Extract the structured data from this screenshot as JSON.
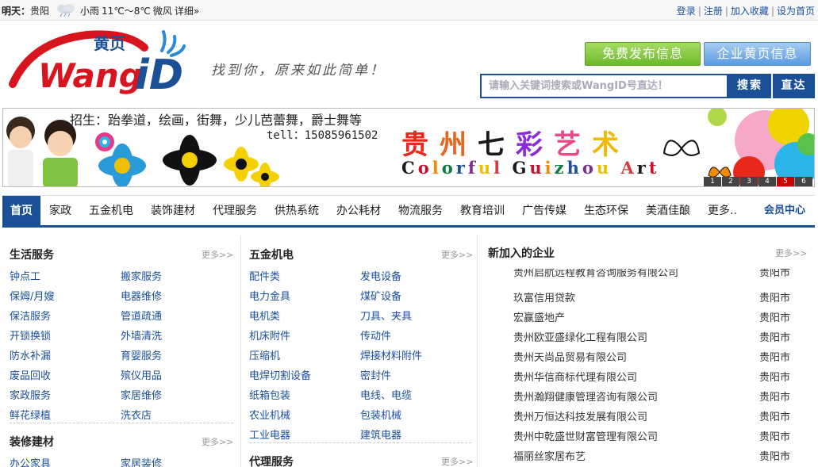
{
  "weather": {
    "label": "明天：",
    "city": "贵阳",
    "icon": "light-rain-icon",
    "condition": "小雨",
    "temp": "11℃～8℃",
    "wind": "微风",
    "detail": "详细»"
  },
  "toplinks": {
    "login": "登录",
    "register": "注册",
    "favorite": "加入收藏",
    "homepage": "设为首页",
    "sep": "|"
  },
  "logo": {
    "cn": "黄页",
    "en": "WangID"
  },
  "slogan": "找到你，原来如此简单！",
  "header": {
    "free_post": "免费发布信息",
    "yellow_pages": "企业黄页信息"
  },
  "search": {
    "placeholder": "请输入关键词搜索或WangID号直达！",
    "search_btn": "搜索",
    "direct_btn": "直达"
  },
  "banner": {
    "line1": "招生：跆拳道，绘画，街舞，少儿芭蕾舞，爵士舞等",
    "line2": "tell：15085961502",
    "title_chars": [
      "贵",
      "州",
      "七",
      "彩",
      "艺",
      "术"
    ],
    "subtitle": "Colorful Guizhou Art",
    "pages": [
      "1",
      "2",
      "3",
      "4",
      "5",
      "6"
    ],
    "active_page": "5",
    "colors": {
      "title": [
        "#e8281a",
        "#e8641a",
        "#1a1a1a",
        "#8a2ad8",
        "#e84a8a",
        "#f0b800"
      ],
      "subtitle": [
        "#1a1a1a",
        "#c8102e",
        "#f28a00",
        "#0a7d3c",
        "#1b4f96",
        "#7b2d8e",
        "#f0c000",
        "#d43a3a"
      ]
    }
  },
  "nav": {
    "items": [
      "首页",
      "家政",
      "五金机电",
      "装饰建材",
      "代理服务",
      "供热系统",
      "办公耗材",
      "物流服务",
      "教育培训",
      "广告传媒",
      "生态环保",
      "美酒佳酿",
      "更多.."
    ],
    "member": "会员中心"
  },
  "col1": {
    "sec1": {
      "title": "生活服务",
      "more": "更多>>",
      "links": [
        "钟点工",
        "搬家服务",
        "保姆/月嫂",
        "电器维修",
        "保洁服务",
        "管道疏通",
        "开锁换锁",
        "外墙清洗",
        "防水补漏",
        "育婴服务",
        "废品回收",
        "殡仪用品",
        "家政服务",
        "家居维修",
        "鲜花绿植",
        "洗衣店"
      ]
    },
    "sec2": {
      "title": "装修建材",
      "more": "更多>>",
      "links": [
        "办公家具",
        "家居装修"
      ]
    }
  },
  "col2": {
    "sec1": {
      "title": "五金机电",
      "more": "更多>>",
      "links": [
        "配件类",
        "发电设备",
        "电力金具",
        "煤矿设备",
        "电机类",
        "刀具、夹具",
        "机床附件",
        "传动件",
        "压缩机",
        "焊接材料附件",
        "电焊切割设备",
        "密封件",
        "纸箱包装",
        "电线、电缆",
        "农业机械",
        "包装机械",
        "工业电器",
        "建筑电器"
      ]
    },
    "sec2": {
      "title": "代理服务",
      "more": "更多>>"
    }
  },
  "col3": {
    "title": "新加入的企业",
    "more": "更多>>",
    "companies": [
      {
        "name": "贵州启航远程教育咨询服务有限公司",
        "city": "贵阳市"
      },
      {
        "name": "玖富信用贷款",
        "city": "贵阳市"
      },
      {
        "name": "宏赢盛地产",
        "city": "贵阳市"
      },
      {
        "name": "贵州欧亚盛绿化工程有限公司",
        "city": "贵阳市"
      },
      {
        "name": "贵州天尚品贸易有限公司",
        "city": "贵阳市"
      },
      {
        "name": "贵州华信商标代理有限公司",
        "city": "贵阳市"
      },
      {
        "name": "贵州瀚翔健康管理咨询有限公司",
        "city": "贵阳市"
      },
      {
        "name": "贵州万恒达科技发展有限公司",
        "city": "贵阳市"
      },
      {
        "name": "贵州中乾盛世财富管理有限公司",
        "city": "贵阳市"
      },
      {
        "name": "福丽丝家居布艺",
        "city": "贵阳市"
      }
    ]
  }
}
